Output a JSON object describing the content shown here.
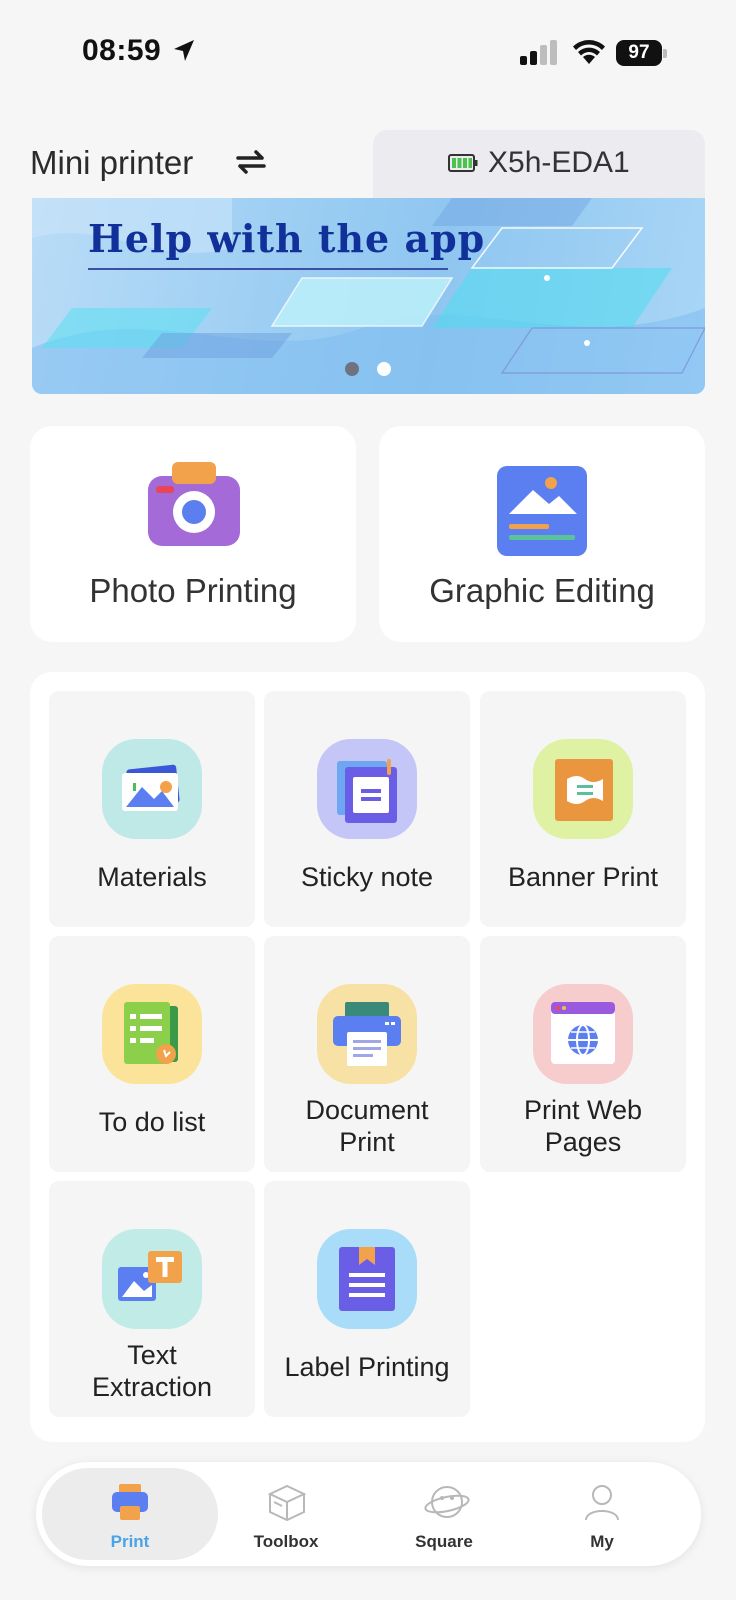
{
  "status_bar": {
    "time": "08:59",
    "battery_percent": "97"
  },
  "header": {
    "title": "Mini printer",
    "device_name": "X5h-EDA1"
  },
  "banner": {
    "title": "Help with the app",
    "slide_count": 2,
    "active_slide": 1
  },
  "features": [
    {
      "label": "Photo Printing",
      "icon": "camera-icon"
    },
    {
      "label": "Graphic Editing",
      "icon": "image-edit-icon"
    }
  ],
  "tools": [
    {
      "label": "Materials",
      "icon": "materials-icon"
    },
    {
      "label": "Sticky note",
      "icon": "sticky-note-icon"
    },
    {
      "label": "Banner Print",
      "icon": "banner-icon"
    },
    {
      "label": "To do list",
      "icon": "todo-icon"
    },
    {
      "label": "Document Print",
      "icon": "document-print-icon"
    },
    {
      "label": "Print Web Pages",
      "icon": "web-page-icon"
    },
    {
      "label": "Text Extraction",
      "icon": "text-extraction-icon"
    },
    {
      "label": "Label Printing",
      "icon": "label-icon"
    }
  ],
  "bottom_nav": {
    "active": "Print",
    "items": [
      {
        "label": "Print",
        "icon": "printer-icon"
      },
      {
        "label": "Toolbox",
        "icon": "toolbox-icon"
      },
      {
        "label": "Square",
        "icon": "planet-icon"
      },
      {
        "label": "My",
        "icon": "person-icon"
      }
    ]
  },
  "colors": {
    "accent": "#4aa3e6",
    "banner_title": "#11309a"
  }
}
